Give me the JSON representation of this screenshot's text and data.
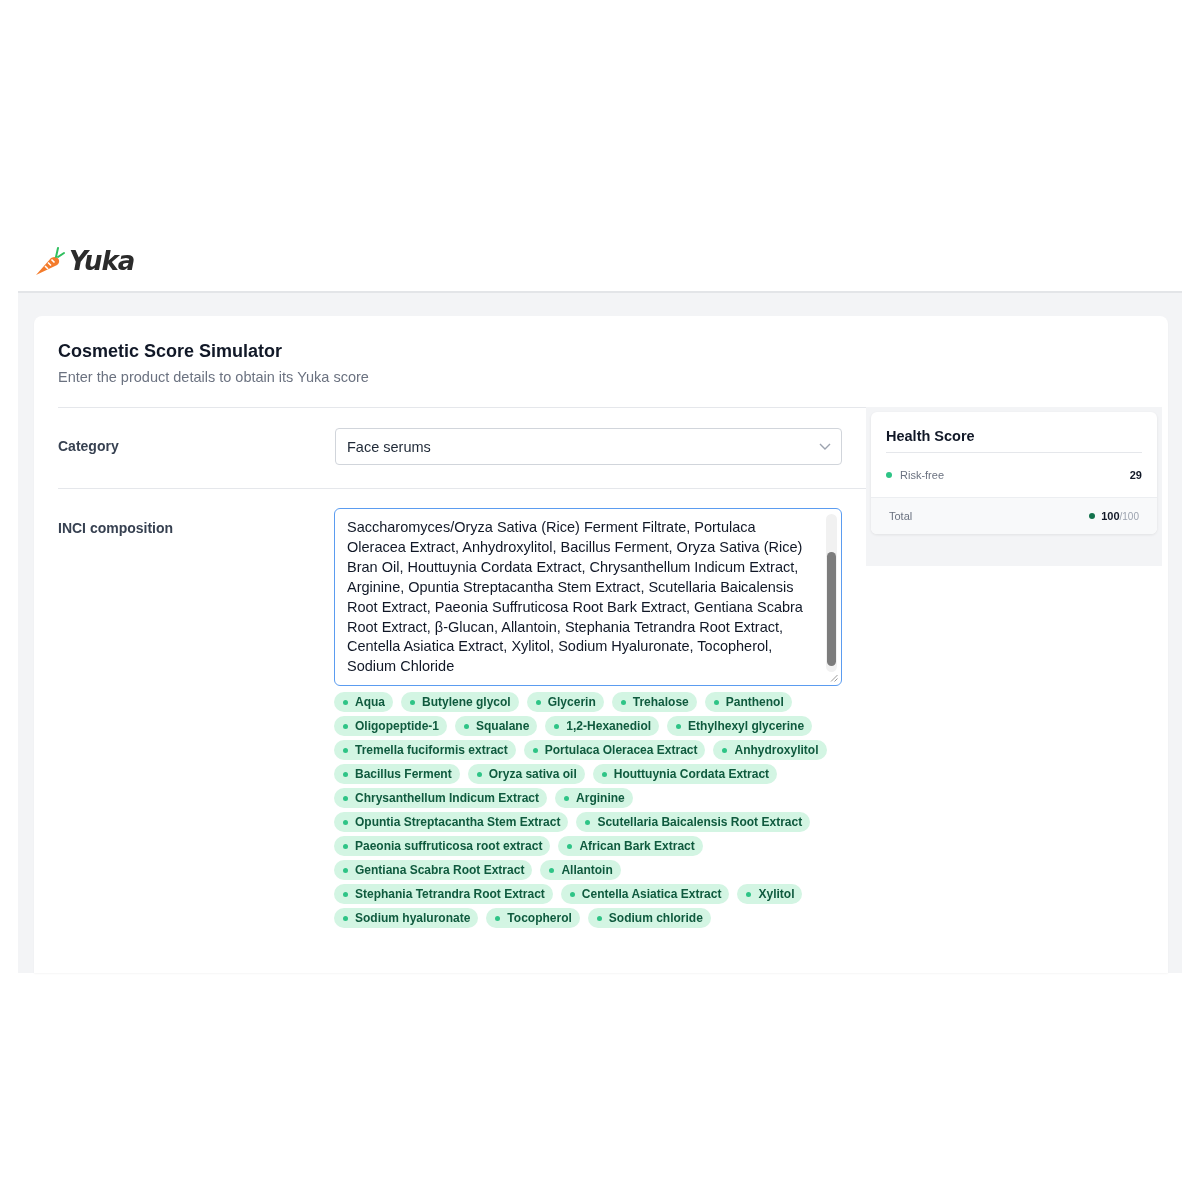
{
  "logo": {
    "text": "Yuka"
  },
  "simulator": {
    "title": "Cosmetic Score Simulator",
    "subtitle": "Enter the product details to obtain its Yuka score"
  },
  "form": {
    "category": {
      "label": "Category",
      "value": "Face serums"
    },
    "inci": {
      "label": "INCI composition",
      "value": "Saccharomyces/Oryza Sativa (Rice) Ferment Filtrate, Portulaca Oleracea Extract, Anhydroxylitol, Bacillus Ferment, Oryza Sativa (Rice) Bran Oil, Houttuynia Cordata Extract, Chrysanthellum Indicum Extract, Arginine, Opuntia Streptacantha Stem Extract, Scutellaria Baicalensis Root Extract, Paeonia Suffruticosa Root Bark Extract, Gentiana Scabra Root Extract, β-Glucan, Allantoin, Stephania Tetrandra Root Extract, Centella Asiatica Extract, Xylitol, Sodium Hyaluronate, Tocopherol, Sodium Chloride"
    },
    "ingredients": [
      "Aqua",
      "Butylene glycol",
      "Glycerin",
      "Trehalose",
      "Panthenol",
      "Oligopeptide-1",
      "Squalane",
      "1,2-Hexanediol",
      "Ethylhexyl glycerine",
      "Tremella fuciformis extract",
      "Portulaca Oleracea Extract",
      "Anhydroxylitol",
      "Bacillus Ferment",
      "Oryza sativa oil",
      "Houttuynia Cordata Extract",
      "Chrysanthellum Indicum Extract",
      "Arginine",
      "Opuntia Streptacantha Stem Extract",
      "Scutellaria Baicalensis Root Extract",
      "Paeonia suffruticosa root extract",
      "African Bark Extract",
      "Gentiana Scabra Root Extract",
      "Allantoin",
      "Stephania Tetrandra Root Extract",
      "Centella Asiatica Extract",
      "Xylitol",
      "Sodium hyaluronate",
      "Tocopherol",
      "Sodium chloride"
    ]
  },
  "health_score": {
    "title": "Health Score",
    "rows": [
      {
        "label": "Risk-free",
        "value": "29",
        "color": "#2ec486"
      }
    ],
    "total": {
      "label": "Total",
      "value": "100",
      "max": "/100",
      "color": "#13724c"
    }
  }
}
